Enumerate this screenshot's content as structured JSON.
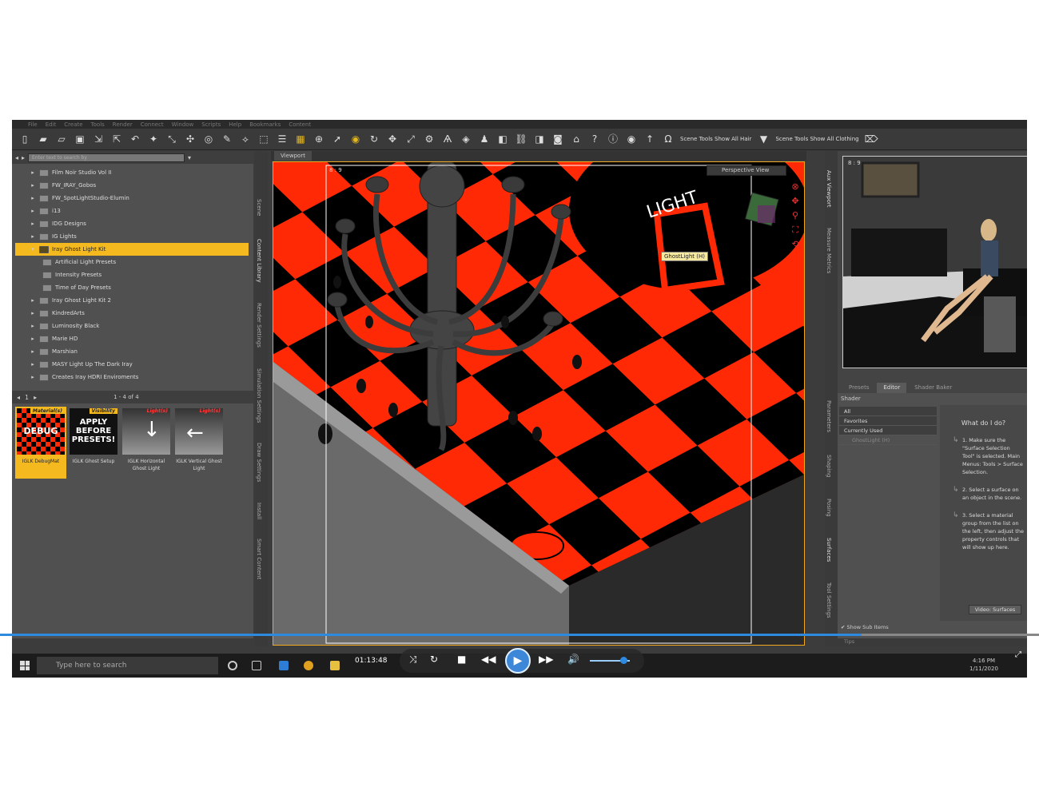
{
  "menu": [
    "File",
    "Edit",
    "Create",
    "Tools",
    "Render",
    "Connect",
    "Window",
    "Scripts",
    "Help",
    "Bookmarks",
    "Content"
  ],
  "toolbar": {
    "scene_tools_hair": "Scene Tools Show All Hair",
    "scene_tools_clothing": "Scene Tools Show All Clothing"
  },
  "content_library": {
    "search_placeholder": "Enter text to search by",
    "tree": [
      {
        "label": "Film Noir Studio Vol II",
        "level": 0,
        "selected": false
      },
      {
        "label": "FW_IRAY_Gobos",
        "level": 0,
        "selected": false
      },
      {
        "label": "FW_SpotLightStudio-Elumin",
        "level": 0,
        "selected": false
      },
      {
        "label": "i13",
        "level": 0,
        "selected": false
      },
      {
        "label": "IDG Designs",
        "level": 0,
        "selected": false
      },
      {
        "label": "IG Lights",
        "level": 0,
        "selected": false
      },
      {
        "label": "Iray Ghost Light Kit",
        "level": 0,
        "selected": true
      },
      {
        "label": "Artificial Light Presets",
        "level": 1,
        "selected": false
      },
      {
        "label": "Intensity Presets",
        "level": 1,
        "selected": false
      },
      {
        "label": "Time of Day Presets",
        "level": 1,
        "selected": false
      },
      {
        "label": "Iray Ghost Light Kit 2",
        "level": 0,
        "selected": false
      },
      {
        "label": "KindredArts",
        "level": 0,
        "selected": false
      },
      {
        "label": "Luminosity Black",
        "level": 0,
        "selected": false
      },
      {
        "label": "Marie HD",
        "level": 0,
        "selected": false
      },
      {
        "label": "Marshian",
        "level": 0,
        "selected": false
      },
      {
        "label": "MASY Light Up The Dark Iray",
        "level": 0,
        "selected": false
      },
      {
        "label": "Creates Iray HDRI Enviroments",
        "level": 0,
        "selected": false
      }
    ],
    "page_number": "1",
    "page_count": "1 - 4 of 4",
    "tiles": [
      {
        "tag": "Material(s)",
        "text": "DEBUG",
        "caption": "IGLK DebugMat",
        "selected": true
      },
      {
        "tag": "Visibility",
        "text": "APPLY BEFORE PRESETS!",
        "caption": "IGLK Ghost Setup",
        "selected": false
      },
      {
        "tag": "Light(s)",
        "text": "",
        "caption": "IGLK Horizontal Ghost Light",
        "selected": false
      },
      {
        "tag": "Light(s)",
        "text": "",
        "caption": "IGLK Vertical Ghost Light",
        "selected": false
      }
    ]
  },
  "left_tabs": [
    "Scene",
    "Content Library",
    "Render Settings",
    "Simulation Settings",
    "Draw Settings",
    "Install",
    "Smart Content"
  ],
  "viewport": {
    "tab": "Viewport",
    "aspect": "8 : 9",
    "view": "Perspective View",
    "ghost_label": "GhostLight (H)",
    "sign": "LIGHT"
  },
  "aux_viewport": {
    "aspect": "8 : 9"
  },
  "right_tabs": [
    "Aux Viewport",
    "Measure Metrics",
    "Parameters",
    "Shaping",
    "Posing",
    "Surfaces",
    "Tool Settings"
  ],
  "surfaces": {
    "tabs": [
      "Presets",
      "Editor",
      "Shader Baker"
    ],
    "shader_label": "Shader",
    "list": [
      "All",
      "Favorites",
      "Currently Used"
    ],
    "sub_item": "GhostLight (H)",
    "help_title": "What do I do?",
    "steps": [
      "1. Make sure the \"Surface Selection Tool\" is selected. Main Menus: Tools > Surface Selection.",
      "2. Select a surface on an object in the scene.",
      "3. Select a material group from the list on the left, then adjust the property controls that will show up here."
    ],
    "video_button": "Video: Surfaces",
    "show_sub": "Show Sub Items",
    "tips": "Tips"
  },
  "player": {
    "timecode": "01:13:48",
    "progress": 0.829,
    "volume": 0.8
  },
  "taskbar": {
    "search_placeholder": "Type here to search",
    "time": "4:16 PM",
    "date": "1/11/2020"
  }
}
